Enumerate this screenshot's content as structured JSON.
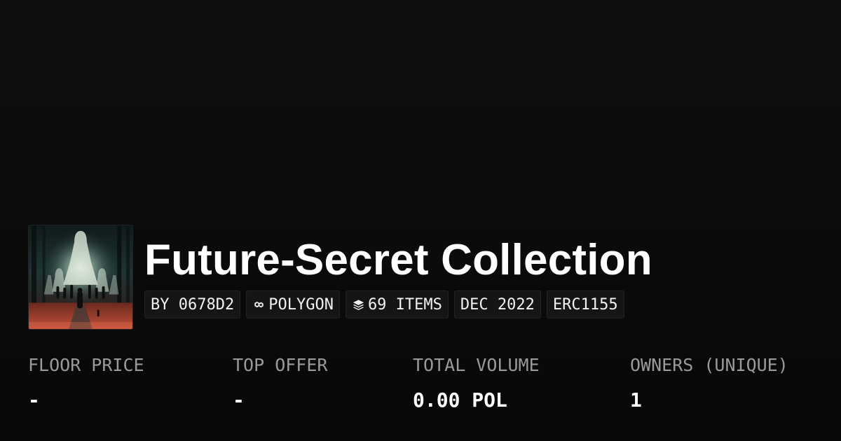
{
  "collection": {
    "title": "Future-Secret Collection",
    "thumbnail_icon": "collection-artwork"
  },
  "chips": {
    "creator": "BY 0678D2",
    "chain_icon": "polygon-icon",
    "chain": "POLYGON",
    "items_icon": "layers-icon",
    "items": "69 ITEMS",
    "date": "DEC 2022",
    "standard": "ERC1155"
  },
  "stats": {
    "floor_price": {
      "label": "FLOOR PRICE",
      "value": "-"
    },
    "top_offer": {
      "label": "TOP OFFER",
      "value": "-"
    },
    "total_volume": {
      "label": "TOTAL VOLUME",
      "value": "0.00 POL"
    },
    "owners": {
      "label": "OWNERS (UNIQUE)",
      "value": "1"
    }
  },
  "colors": {
    "background": "#0b0b0b",
    "chip_background": "#151515",
    "label": "#9a9a9a",
    "text": "#ffffff"
  }
}
